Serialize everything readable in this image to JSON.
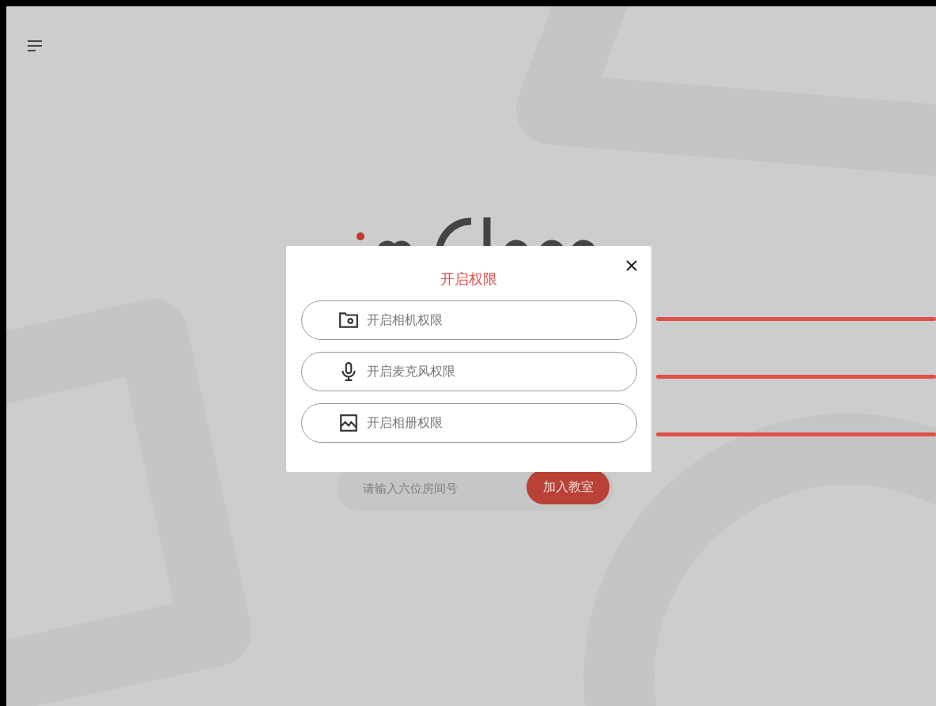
{
  "dialog": {
    "title": "开启权限",
    "permissions": [
      {
        "kind": "camera",
        "label": "开启相机权限"
      },
      {
        "kind": "microphone",
        "label": "开启麦克风权限"
      },
      {
        "kind": "album",
        "label": "开启相册权限"
      }
    ]
  },
  "join": {
    "placeholder": "请输入六位房间号",
    "button": "加入教室"
  }
}
